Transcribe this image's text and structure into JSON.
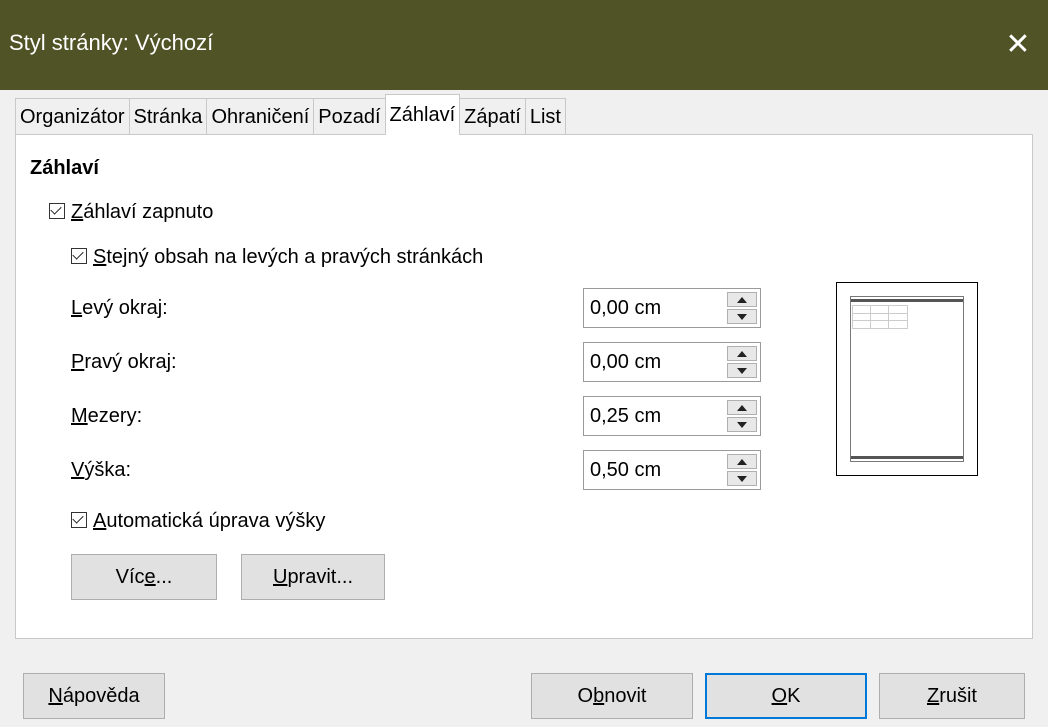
{
  "window": {
    "title": "Styl stránky: Výchozí",
    "close_glyph": "✕"
  },
  "tabs": [
    {
      "label": "Organizátor"
    },
    {
      "label": "Stránka"
    },
    {
      "label": "Ohraničení"
    },
    {
      "label": "Pozadí"
    },
    {
      "label": "Záhlaví"
    },
    {
      "label": "Zápatí"
    },
    {
      "label": "List"
    }
  ],
  "active_tab": "Záhlaví",
  "header": {
    "section_title": "Záhlaví",
    "enabled": {
      "first": "Z",
      "rest": "áhlaví zapnuto",
      "checked": true
    },
    "same_content": {
      "first": "S",
      "rest": "tejný obsah na levých a pravých stránkách",
      "checked": true
    },
    "left_margin": {
      "first": "L",
      "rest": "evý okraj:",
      "value": "0,00 cm"
    },
    "right_margin": {
      "first": "P",
      "rest": "ravý okraj:",
      "value": "0,00 cm"
    },
    "spacing": {
      "first": "M",
      "rest": "ezery:",
      "value": "0,25 cm"
    },
    "height": {
      "first": "V",
      "rest": "ýška:",
      "value": "0,50 cm"
    },
    "autofit": {
      "first": "A",
      "rest": "utomatická úprava výšky",
      "checked": true
    },
    "more_button": {
      "pre": "Víc",
      "u": "e",
      "post": "..."
    },
    "edit_button": {
      "pre": "",
      "u": "U",
      "post": "pravit..."
    }
  },
  "footer_buttons": {
    "help": {
      "pre": "",
      "u": "N",
      "post": "ápověda"
    },
    "reset": {
      "pre": "O",
      "u": "b",
      "post": "novit"
    },
    "ok": {
      "pre": "",
      "u": "O",
      "post": "K"
    },
    "cancel": {
      "pre": "",
      "u": "Z",
      "post": "rušit"
    }
  },
  "colors": {
    "titlebar": "#4f5326",
    "accent": "#0078d7"
  }
}
